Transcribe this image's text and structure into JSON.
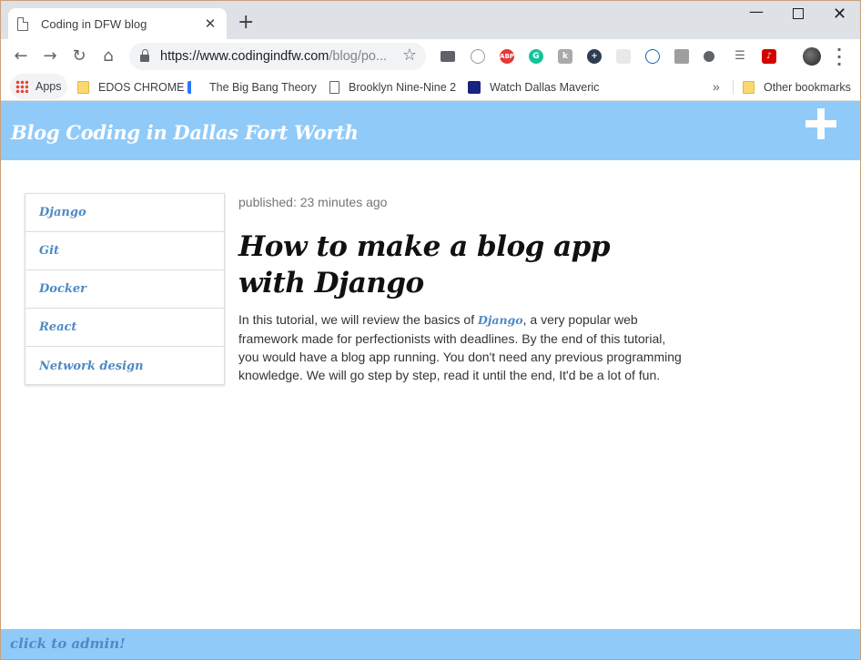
{
  "browser": {
    "tab_title": "Coding in DFW blog",
    "tab_close": "✕",
    "new_tab": "+",
    "url_host": "https://www.codingindfw.com",
    "url_path": "/blog/po...",
    "bookmarks": {
      "apps": "Apps",
      "items": [
        "EDOS CHROME",
        "The Big Bang Theory",
        "Brooklyn Nine-Nine 2",
        "Watch Dallas Maveric"
      ],
      "more": "»",
      "other": "Other bookmarks"
    }
  },
  "site": {
    "title": "Blog Coding in Dallas Fort Worth",
    "sidebar": [
      "Django",
      "Git",
      "Docker",
      "React",
      "Network design"
    ],
    "footer_link": "click to admin!"
  },
  "post": {
    "published": "published: 23 minutes ago",
    "title": "How to make a blog app with Django",
    "body_before": "In this tutorial, we will review the basics of ",
    "body_link": "Django",
    "body_after": ", a very popular web framework made for perfectionists with deadlines. By the end of this tutorial, you would have a blog app running. You don't need any previous programming knowledge. We will go step by step, read it until the end, It'd be a lot of fun."
  },
  "colors": {
    "header_bg": "#90caf9",
    "link": "#4e8ac4"
  }
}
